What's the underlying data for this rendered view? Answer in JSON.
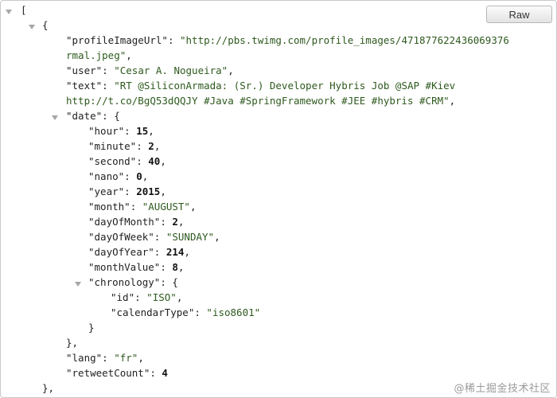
{
  "toolbar": {
    "raw_label": "Raw"
  },
  "json": {
    "open_array": "[",
    "open_obj": "{",
    "profile_key": "\"profileImageUrl\"",
    "profile_val": "\"http://pbs.twimg.com/profile_images/471877622436069376",
    "profile_val_cont": "rmal.jpeg\"",
    "user_key": "\"user\"",
    "user_val": "\"Cesar A. Nogueira\"",
    "text_key": "\"text\"",
    "text_val": "\"RT @SiliconArmada: (Sr.) Developer Hybris Job @SAP #Kiev",
    "text_val_cont": "http://t.co/BgQ53dQQJY #Java #SpringFramework #JEE #hybris #CRM\"",
    "date_key": "\"date\"",
    "hour_key": "\"hour\"",
    "hour_val": "15",
    "minute_key": "\"minute\"",
    "minute_val": "2",
    "second_key": "\"second\"",
    "second_val": "40",
    "nano_key": "\"nano\"",
    "nano_val": "0",
    "year_key": "\"year\"",
    "year_val": "2015",
    "month_key": "\"month\"",
    "month_val": "\"AUGUST\"",
    "dayofmonth_key": "\"dayOfMonth\"",
    "dayofmonth_val": "2",
    "dayofweek_key": "\"dayOfWeek\"",
    "dayofweek_val": "\"SUNDAY\"",
    "dayofyear_key": "\"dayOfYear\"",
    "dayofyear_val": "214",
    "monthvalue_key": "\"monthValue\"",
    "monthvalue_val": "8",
    "chronology_key": "\"chronology\"",
    "id_key": "\"id\"",
    "id_val": "\"ISO\"",
    "calendartype_key": "\"calendarType\"",
    "calendartype_val": "\"iso8601\"",
    "close_inner": "}",
    "close_date": "},",
    "lang_key": "\"lang\"",
    "lang_val": "\"fr\"",
    "retweet_key": "\"retweetCount\"",
    "retweet_val": "4",
    "close_obj": "},"
  },
  "watermark": "@稀土掘金技术社区"
}
